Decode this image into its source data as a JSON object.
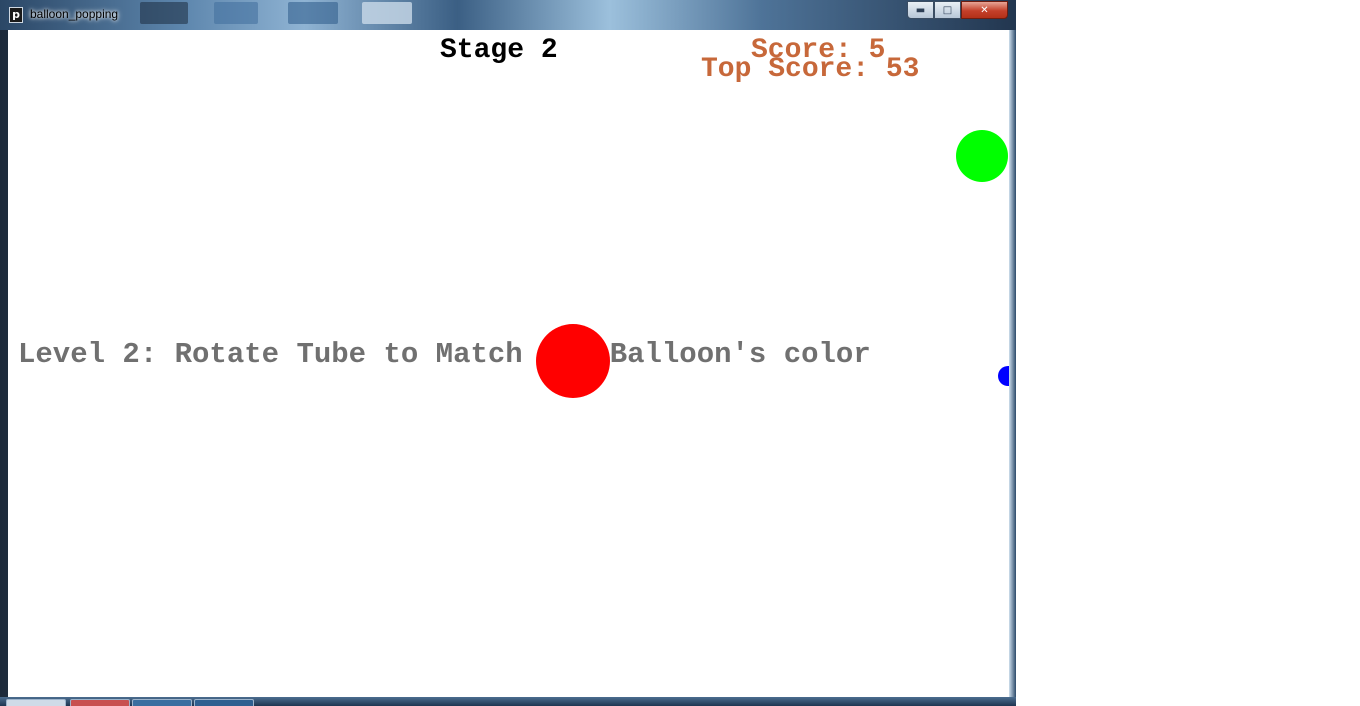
{
  "window": {
    "title": "balloon_popping",
    "app_icon_glyph": "p",
    "controls": {
      "minimize_icon": "minimize-icon",
      "maximize_icon": "maximize-icon",
      "close_icon": "close-icon"
    }
  },
  "game": {
    "stage_label": "Stage 2",
    "score_label": "Score: 5",
    "top_score_label": "Top Score: 53",
    "instruction": "Level 2: Rotate Tube to Match the Balloon's color",
    "colors": {
      "stage_text": "#000000",
      "score_text": "#c7683a",
      "instruction_text": "#707070",
      "background": "#ffffff"
    },
    "balloons": [
      {
        "name": "red-balloon",
        "color": "#ff0000"
      },
      {
        "name": "green-balloon",
        "color": "#00ff00"
      },
      {
        "name": "blue-balloon",
        "color": "#0000ff"
      }
    ]
  }
}
